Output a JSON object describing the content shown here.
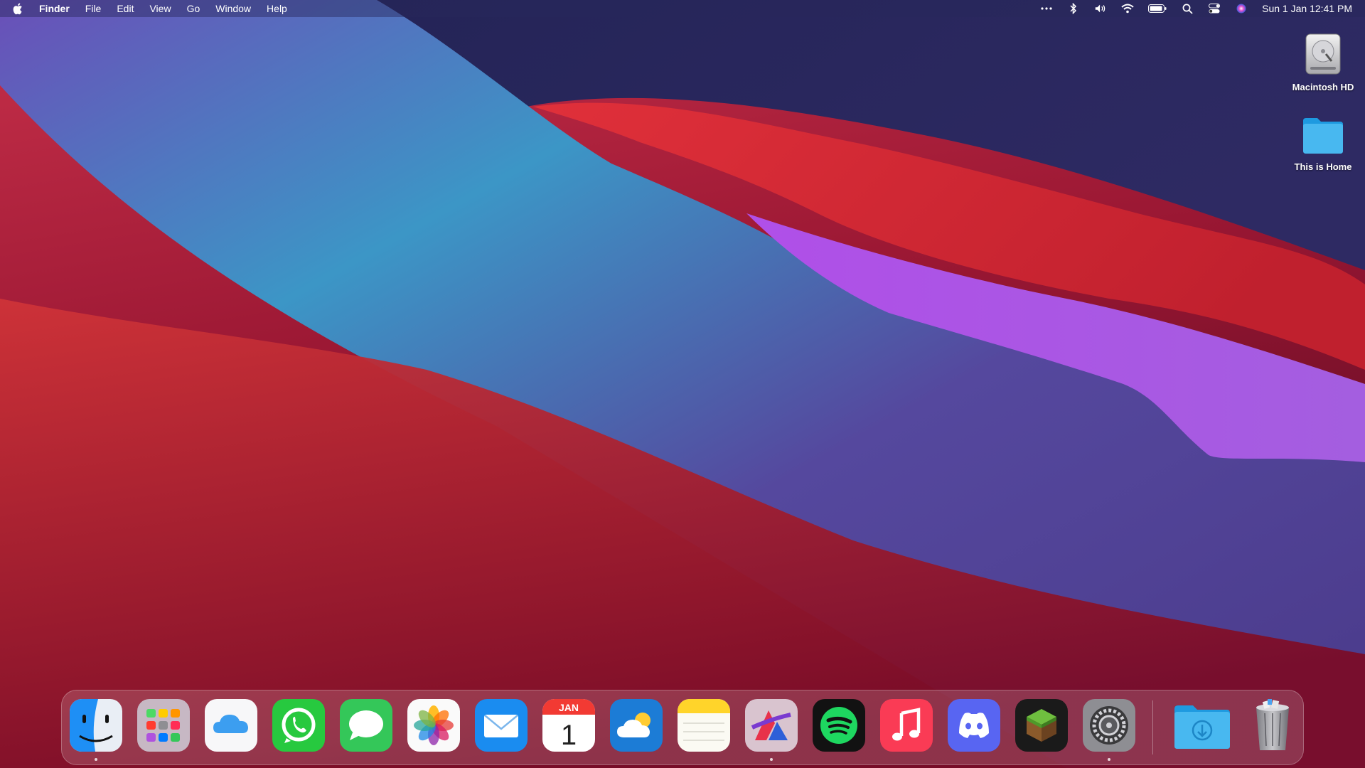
{
  "menubar": {
    "apple_icon": "apple-logo-icon",
    "app_name": "Finder",
    "menus": [
      "File",
      "Edit",
      "View",
      "Go",
      "Window",
      "Help"
    ],
    "status_icons": [
      "more-icon",
      "bluetooth-icon",
      "volume-icon",
      "wifi-icon",
      "battery-icon",
      "search-icon",
      "control-center-icon",
      "siri-icon"
    ],
    "clock": "Sun 1 Jan  12:41 PM"
  },
  "desktop": {
    "icons": [
      {
        "label": "Macintosh HD",
        "icon": "hard-drive-icon"
      },
      {
        "label": "This is Home",
        "icon": "folder-icon"
      }
    ]
  },
  "dock": {
    "apps": [
      {
        "name": "Finder",
        "icon": "finder-icon",
        "running": true
      },
      {
        "name": "Launchpad",
        "icon": "launchpad-icon",
        "running": false
      },
      {
        "name": "iCloud",
        "icon": "icloud-icon",
        "running": false
      },
      {
        "name": "WhatsApp",
        "icon": "whatsapp-icon",
        "running": false
      },
      {
        "name": "Messages",
        "icon": "messages-icon",
        "running": false
      },
      {
        "name": "Photos",
        "icon": "photos-icon",
        "running": false
      },
      {
        "name": "Mail",
        "icon": "mail-icon",
        "running": false
      },
      {
        "name": "Calendar",
        "icon": "calendar-icon",
        "running": false
      },
      {
        "name": "Weather",
        "icon": "weather-icon",
        "running": false
      },
      {
        "name": "Notes",
        "icon": "notes-icon",
        "running": false
      },
      {
        "name": "Affinity",
        "icon": "affinity-icon",
        "running": true
      },
      {
        "name": "Spotify",
        "icon": "spotify-icon",
        "running": false
      },
      {
        "name": "Music",
        "icon": "music-icon",
        "running": false
      },
      {
        "name": "Discord",
        "icon": "discord-icon",
        "running": false
      },
      {
        "name": "Minecraft",
        "icon": "minecraft-icon",
        "running": false
      },
      {
        "name": "System Preferences",
        "icon": "settings-gear-icon",
        "running": true
      },
      {
        "name": "Downloads",
        "icon": "downloads-folder-icon",
        "running": false
      },
      {
        "name": "Trash",
        "icon": "trash-icon",
        "running": false
      }
    ],
    "calendar": {
      "month": "JAN",
      "day": "1"
    }
  },
  "colors": {
    "wallpaper_red": "#c92a35",
    "wallpaper_blue": "#3a8fc0",
    "wallpaper_purple": "#a653e0",
    "wallpaper_navy": "#1c1f4a",
    "dock_bg": "rgba(255,255,255,0.16)"
  }
}
